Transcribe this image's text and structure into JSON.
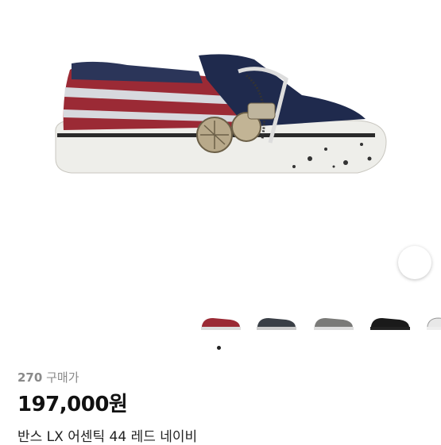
{
  "product": {
    "purchase_count": "270",
    "purchase_label": "구매가",
    "price": "197,000원",
    "title": "반스 LX 어센틱 44 레드 네이비"
  },
  "gallery": {
    "thumbnails": [
      "thumb-1",
      "thumb-2",
      "thumb-3",
      "thumb-4",
      "thumb-5"
    ],
    "active_index": 0
  },
  "icons": {
    "lens": "image-search-icon"
  },
  "colors": {
    "price_text": "#111111",
    "muted_text": "#8a8a8a",
    "navy": "#1f2a4d",
    "red": "#9b2a35"
  }
}
